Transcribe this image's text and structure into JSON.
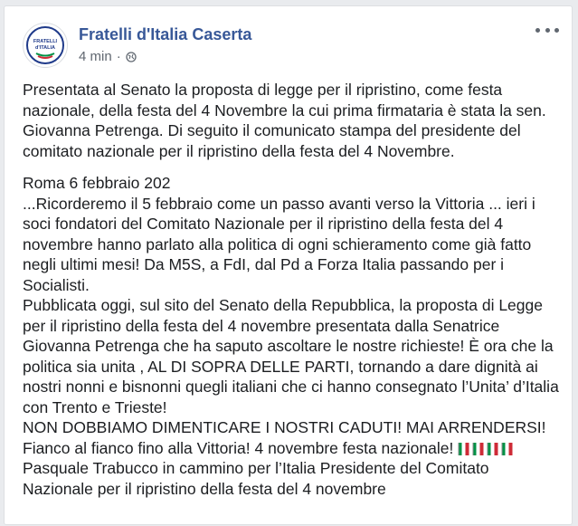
{
  "post": {
    "page_name": "Fratelli d'Italia Caserta",
    "timestamp": "4 min",
    "separator": "·",
    "privacy_icon": "globe-icon",
    "more_icon": "more-options-icon",
    "avatar_logo_text": [
      "FRATELLI",
      "d'ITALIA"
    ],
    "paragraphs_1": [
      "Presentata al Senato la proposta di legge per il ripristino, come festa",
      "nazionale, della festa del 4 Novembre la cui prima firmataria è stata la sen.",
      "Giovanna Petrenga. Di seguito il comunicato stampa del presidente del",
      "comitato nazionale per il ripristino della festa del 4 Novembre."
    ],
    "paragraphs_2": [
      "Roma 6 febbraio 202",
      "...Ricorderemo il 5 febbraio come un passo avanti verso la Vittoria ... ieri i",
      "soci fondatori del Comitato Nazionale per il ripristino della festa del 4",
      "novembre hanno parlato alla politica di ogni schieramento come già fatto",
      "negli ultimi mesi! Da M5S, a FdI, dal Pd a Forza Italia passando per i",
      "Socialisti.",
      "Pubblicata oggi, sul sito del Senato della Repubblica, la proposta di Legge",
      "per il ripristino della festa del 4 novembre presentata dalla Senatrice",
      "Giovanna Petrenga che ha saputo ascoltare le nostre richieste! È ora che la",
      "politica sia unita , AL DI SOPRA DELLE PARTI, tornando a dare dignità ai",
      "nostri nonni e bisnonni quegli italiani che ci hanno consegnato l’Unita’ d’Italia",
      "con Trento e Trieste!",
      "NON DOBBIAMO DIMENTICARE I NOSTRI CADUTI! MAI ARRENDERSI!"
    ],
    "flag_line": "Fianco al fianco fino alla Vittoria! 4 novembre festa nazionale! ",
    "flag_icon": "italian-flag-icon",
    "flag_count": 4,
    "paragraphs_3": [
      "Pasquale Trabucco in cammino per l’Italia Presidente del Comitato",
      "Nazionale per il ripristino della festa del 4 novembre"
    ],
    "colors": {
      "name": "#385898",
      "text": "#1c1e21",
      "meta": "#606770",
      "flag_green": "#009246",
      "flag_white": "#ffffff",
      "flag_red": "#ce2b37",
      "logo_blue": "#1f3a8a"
    }
  }
}
